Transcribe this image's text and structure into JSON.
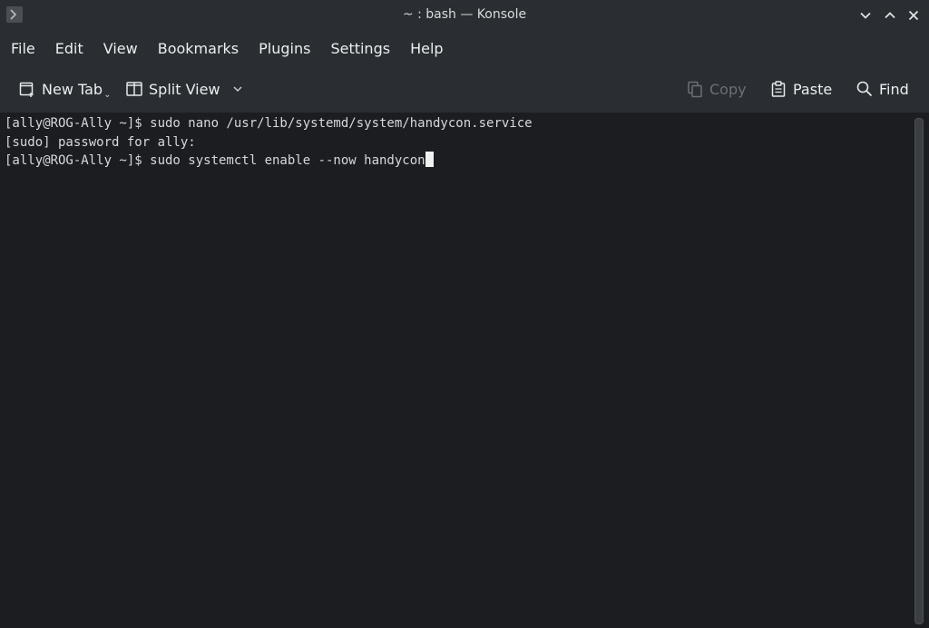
{
  "window": {
    "title": "~ : bash — Konsole"
  },
  "menubar": {
    "items": [
      {
        "label": "File"
      },
      {
        "label": "Edit"
      },
      {
        "label": "View"
      },
      {
        "label": "Bookmarks"
      },
      {
        "label": "Plugins"
      },
      {
        "label": "Settings"
      },
      {
        "label": "Help"
      }
    ]
  },
  "toolbar": {
    "new_tab": {
      "label": "New Tab",
      "icon": "new-tab-icon"
    },
    "split_view": {
      "label": "Split View",
      "icon": "split-view-icon"
    },
    "copy": {
      "label": "Copy",
      "icon": "copy-icon",
      "enabled": false
    },
    "paste": {
      "label": "Paste",
      "icon": "paste-icon"
    },
    "find": {
      "label": "Find",
      "icon": "search-icon"
    }
  },
  "terminal": {
    "lines": [
      "[ally@ROG-Ally ~]$ sudo nano /usr/lib/systemd/system/handycon.service",
      "[sudo] password for ally:",
      "[ally@ROG-Ally ~]$ sudo systemctl enable --now handycon"
    ]
  },
  "colors": {
    "background": "#1b1d20",
    "chrome": "#2a2e32",
    "text": "#d6d9dc",
    "disabled": "#6c7075"
  }
}
